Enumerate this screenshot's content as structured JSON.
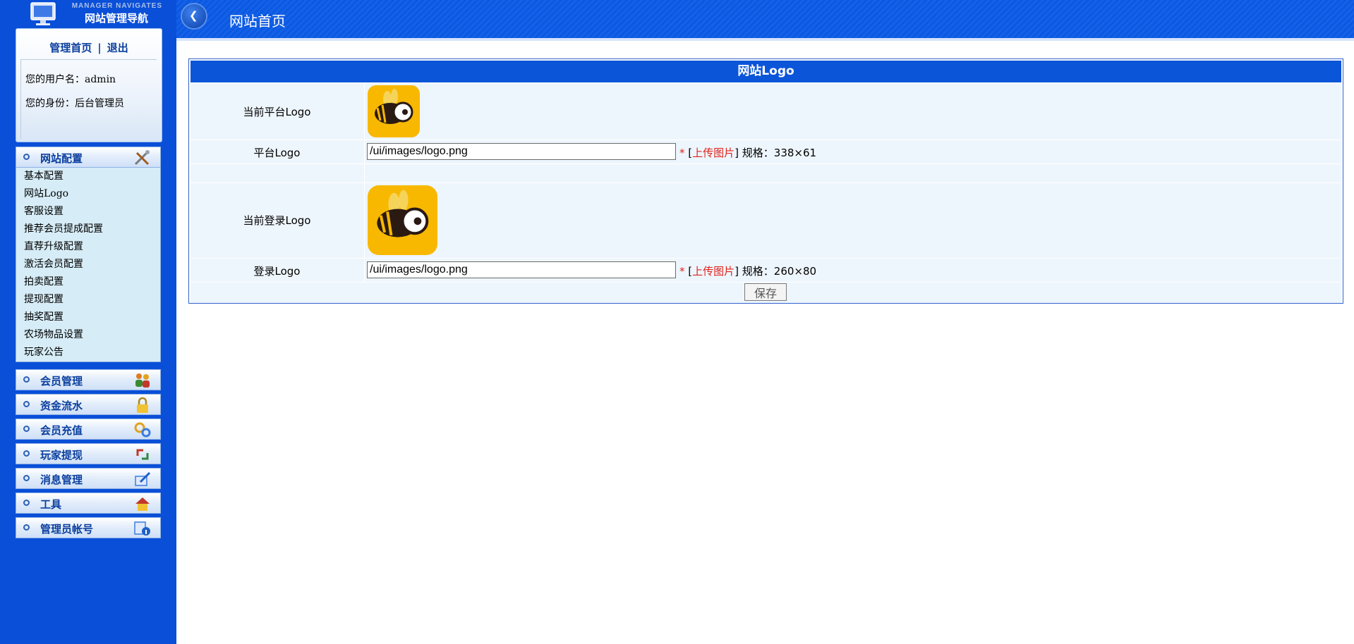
{
  "sidebar": {
    "brand_sub": "MANAGER NAVIGATES",
    "brand_title": "网站管理导航",
    "home_link": "管理首页",
    "separator": "|",
    "logout_link": "退出",
    "username_label": "您的用户名：admin",
    "role_label": "您的身份：后台管理员",
    "sections": [
      {
        "label": "网站配置",
        "icon": "tools-icon"
      },
      {
        "label": "会员管理",
        "icon": "users-icon"
      },
      {
        "label": "资金流水",
        "icon": "lock-icon"
      },
      {
        "label": "会员充值",
        "icon": "gears-icon"
      },
      {
        "label": "玩家提现",
        "icon": "transfer-icon"
      },
      {
        "label": "消息管理",
        "icon": "edit-icon"
      },
      {
        "label": "工具",
        "icon": "house-icon"
      },
      {
        "label": "管理员帐号",
        "icon": "admin-info-icon"
      }
    ],
    "submenu": [
      "基本配置",
      "网站Logo",
      "客服设置",
      "推荐会员提成配置",
      "直荐升级配置",
      "激活会员配置",
      "拍卖配置",
      "提现配置",
      "抽奖配置",
      "农场物品设置",
      "玩家公告"
    ]
  },
  "header": {
    "back_icon": "chevron-left-icon",
    "title": "网站首页"
  },
  "form": {
    "title": "网站Logo",
    "current_platform_label": "当前平台Logo",
    "platform_label": "平台Logo",
    "platform_value": "/ui/images/logo.png",
    "current_login_label": "当前登录Logo",
    "login_label": "登录Logo",
    "login_value": "/ui/images/logo.png",
    "required_mark": "*",
    "bracket_open": "[",
    "upload_link": "上传图片",
    "bracket_close": "]",
    "platform_spec": "规格：338×61",
    "login_spec": "规格：260×80",
    "save_button": "保存"
  },
  "colors": {
    "sidebar_bg": "#0a4fd8",
    "header_bg": "#0b55d9",
    "row_bg": "#eef6fd",
    "accent_red": "#e0221b",
    "logo_yellow": "#f8b800"
  }
}
